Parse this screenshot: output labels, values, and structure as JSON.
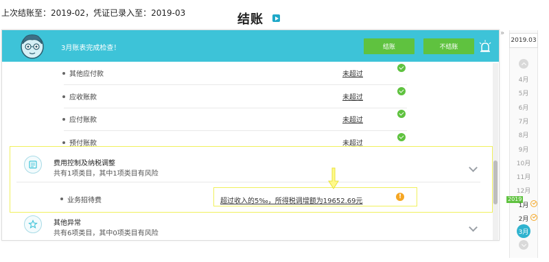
{
  "header": {
    "info": "上次结账至：2019-02，凭证已录入至：2019-03",
    "title": "结账"
  },
  "banner": {
    "message": "3月账表完成检查！",
    "settle_label": "结账",
    "no_settle_label": "不结账"
  },
  "rows": [
    {
      "label": "其他应付款",
      "status": "未超过"
    },
    {
      "label": "应收账款",
      "status": "未超过"
    },
    {
      "label": "应付账款",
      "status": "未超过"
    },
    {
      "label": "预付账款",
      "status": "未超过"
    }
  ],
  "sections": [
    {
      "title": "费用控制及纳税调整",
      "subtitle": "共有1项类目，其中1项类目有风险",
      "item_label": "业务招待费",
      "item_status": "超过收入的5‰，所得税调增额为19652.69元",
      "warn_glyph": "!"
    },
    {
      "title": "其他异常",
      "subtitle": "共有6项类目，其中0项类目有风险"
    }
  ],
  "calendar": {
    "collapse": "»",
    "year": "2019.03",
    "year_tag": "2019",
    "months": [
      "4月",
      "5月",
      "6月",
      "7月",
      "8月",
      "9月",
      "10月",
      "11月",
      "12月",
      "1月",
      "2月"
    ],
    "current": "3月"
  },
  "colors": {
    "banner": "#3dc3d8",
    "button": "#5fc23f",
    "highlight": "#f0f05a",
    "warn": "#f5a623",
    "current_month": "#2fb3cf"
  }
}
